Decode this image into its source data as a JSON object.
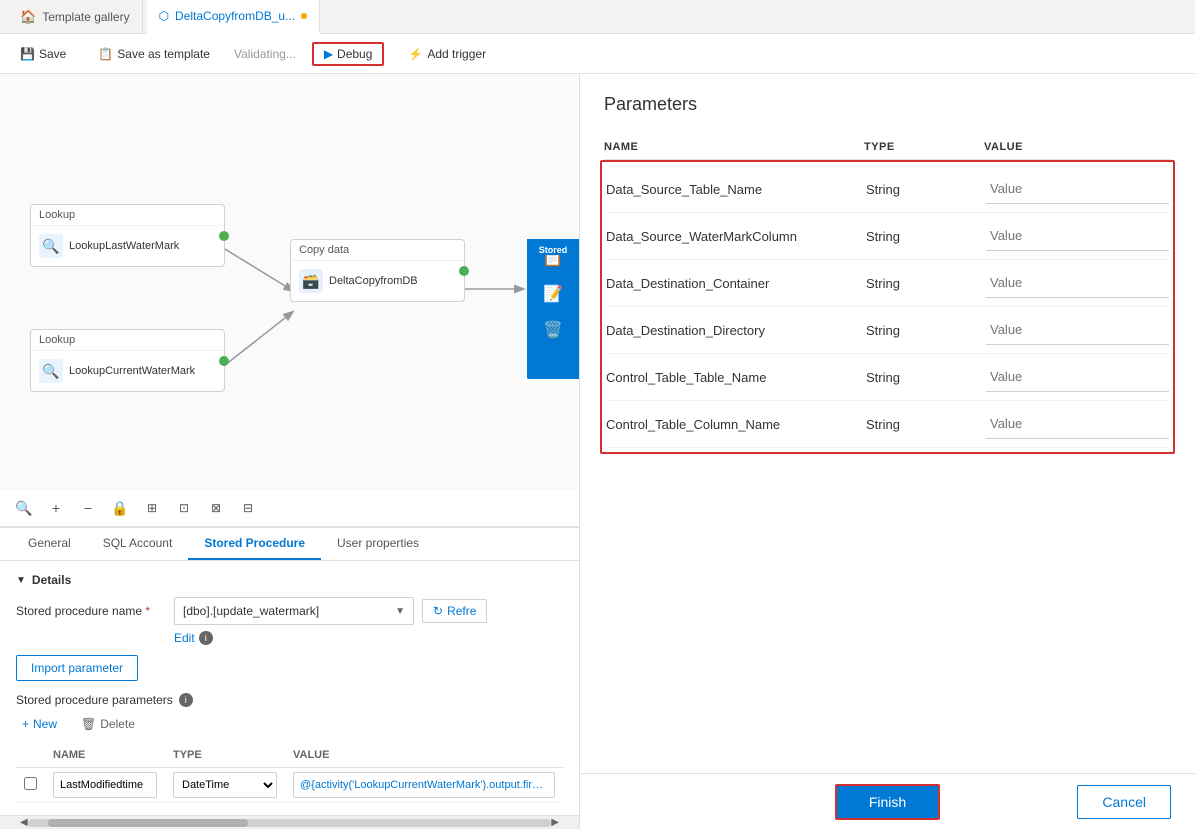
{
  "tabs": {
    "gallery": {
      "label": "Template gallery",
      "icon": "🏠"
    },
    "pipeline": {
      "label": "DeltaCopyfromDB_u...",
      "icon": "⬡",
      "dot": true
    }
  },
  "toolbar": {
    "save_label": "Save",
    "save_as_label": "Save as template",
    "validating_label": "Validating...",
    "debug_label": "Debug",
    "add_trigger_label": "Add trigger"
  },
  "canvas": {
    "lookup1": {
      "header": "Lookup",
      "name": "LookupLastWaterMark"
    },
    "lookup2": {
      "header": "Lookup",
      "name": "LookupCurrentWaterMark"
    },
    "copy_data": {
      "header": "Copy data",
      "name": "DeltaCopyfromDB"
    },
    "stored": {
      "label": "Stored"
    }
  },
  "mini_toolbar": {
    "tools": [
      "🔍",
      "+",
      "−",
      "🔒",
      "⊞",
      "⊡",
      "⊠",
      "⊟"
    ]
  },
  "panel": {
    "tabs": [
      "General",
      "SQL Account",
      "Stored Procedure",
      "User properties"
    ],
    "active_tab": "Stored Procedure",
    "details_label": "Details",
    "stored_proc_name_label": "Stored procedure name",
    "stored_proc_name_required": "*",
    "stored_proc_name_value": "[dbo].[update_watermark]",
    "edit_label": "Edit",
    "import_btn_label": "Import parameter",
    "stored_proc_params_label": "Stored procedure parameters",
    "add_label": "New",
    "delete_label": "Delete",
    "table_headers": [
      "NAME",
      "TYPE",
      "VALUE"
    ],
    "table_row": {
      "name": "LastModifiedtime",
      "type": "DateTime",
      "value": "@{activity('LookupCurrentWaterMark').output.firstRow.NewWatermarkValue}"
    },
    "refresh_label": "Refre"
  },
  "right_panel": {
    "title": "Parameters",
    "headers": [
      "NAME",
      "TYPE",
      "VALUE"
    ],
    "rows": [
      {
        "name": "Data_Source_Table_Name",
        "type": "String",
        "value": "Value"
      },
      {
        "name": "Data_Source_WaterMarkColumn",
        "type": "String",
        "value": "Value"
      },
      {
        "name": "Data_Destination_Container",
        "type": "String",
        "value": "Value"
      },
      {
        "name": "Data_Destination_Directory",
        "type": "String",
        "value": "Value"
      },
      {
        "name": "Control_Table_Table_Name",
        "type": "String",
        "value": "Value"
      },
      {
        "name": "Control_Table_Column_Name",
        "type": "String",
        "value": "Value"
      }
    ],
    "finish_label": "Finish",
    "cancel_label": "Cancel"
  }
}
